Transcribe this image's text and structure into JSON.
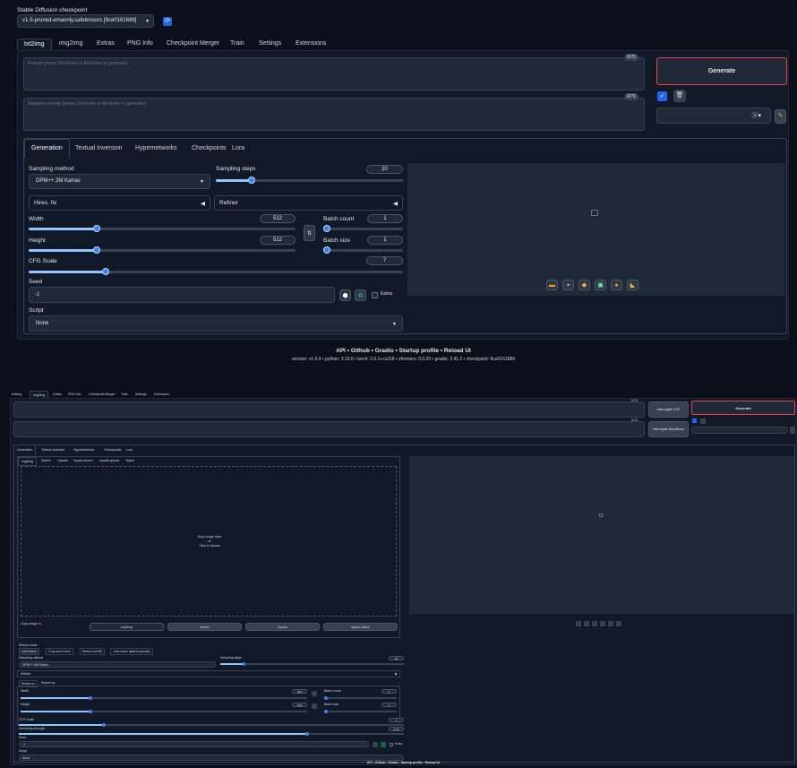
{
  "top": {
    "checkpoint_label": "Stable Diffusion checkpoint",
    "checkpoint_value": "v1-5-pruned-emaonly.safetensors [6ce0161689]",
    "tabs": [
      "txt2img",
      "img2img",
      "Extras",
      "PNG Info",
      "Checkpoint Merger",
      "Train",
      "Settings",
      "Extensions"
    ],
    "prompt_placeholder": "Prompt (press Ctrl+Enter or Alt+Enter to generate)",
    "neg_placeholder": "Negative prompt (press Ctrl+Enter or Alt+Enter to generate)",
    "prompt_count": "0/75",
    "neg_count": "0/75",
    "generate": "Generate",
    "subtabs": [
      "Generation",
      "Textual Inversion",
      "Hypernetworks",
      "Checkpoints",
      "Lora"
    ],
    "sampling_method_label": "Sampling method",
    "sampling_method": "DPM++ 2M Karras",
    "sampling_steps_label": "Sampling steps",
    "sampling_steps": "20",
    "hires": "Hires. fix",
    "refiner": "Refiner",
    "width_label": "Width",
    "width": "512",
    "height_label": "Height",
    "height": "512",
    "batch_count_label": "Batch count",
    "batch_count": "1",
    "batch_size_label": "Batch size",
    "batch_size": "1",
    "cfg_label": "CFG Scale",
    "cfg": "7",
    "seed_label": "Seed",
    "seed": "-1",
    "extra": "Extra",
    "script_label": "Script",
    "script": "None",
    "footer_links": "API  •  Github  •  Gradio  •  Startup profile  •  Reload UI",
    "footer_version": "version: v1.6.0  •  python: 3.10.6  •  torch: 2.0.1+cu118  •  xformers: 0.0.20  •  gradio: 3.41.2  •  checkpoint: 6ce0161689",
    "sliders": {
      "steps": 0.2,
      "width": 0.25,
      "height": 0.25,
      "batch_count": 0,
      "batch_size": 0,
      "cfg": 0.2
    }
  },
  "bottom": {
    "tabs": [
      "txt2img",
      "img2img",
      "Extras",
      "PNG Info",
      "Checkpoint Merger",
      "Train",
      "Settings",
      "Extensions"
    ],
    "interrogate_clip": "Interrogate CLIP",
    "interrogate_deepbooru": "Interrogate DeepBooru",
    "generate": "Generate",
    "prompt_count": "0/75",
    "neg_count": "0/75",
    "subtabs": [
      "Generation",
      "Textual Inversion",
      "Hypernetworks",
      "Checkpoints",
      "Lora"
    ],
    "modetabs": [
      "img2img",
      "Sketch",
      "Inpaint",
      "Inpaint sketch",
      "Inpaint upload",
      "Batch"
    ],
    "drop_text": "Drop Image Here",
    "drop_or": "- or -",
    "drop_click": "Click to Upload",
    "copy_label": "Copy image to:",
    "copy_buttons": [
      "img2img",
      "sketch",
      "inpaint",
      "inpaint sketch"
    ],
    "resize_label": "Resize mode",
    "resize_opts": [
      "Just resize",
      "Crop and resize",
      "Resize and fill",
      "Just resize (latent upscale)"
    ],
    "sampling_method_label": "Sampling method",
    "sampling_method": "DPM++ 2M Karras",
    "sampling_steps_label": "Sampling steps",
    "sampling_steps": "20",
    "refiner": "Refiner",
    "resize_tabs": [
      "Resize to",
      "Resize by"
    ],
    "width_label": "Width",
    "width": "512",
    "height_label": "Height",
    "height": "512",
    "batch_count_label": "Batch count",
    "batch_count": "1",
    "batch_size_label": "Batch size",
    "batch_size": "1",
    "cfg_label": "CFG Scale",
    "cfg": "7",
    "denoise_label": "Denoising strength",
    "denoise": "0.75",
    "seed_label": "Seed",
    "seed": "-1",
    "extra": "Extra",
    "script_label": "Script",
    "script": "None",
    "footer_links": "API  •  Github  •  Gradio  •  Startup profile  •  Reload UI"
  },
  "colors": {
    "accent": "#3b82f6",
    "generate_border": "#ef4444",
    "bg": "#0b0f19",
    "panel": "#111827"
  }
}
